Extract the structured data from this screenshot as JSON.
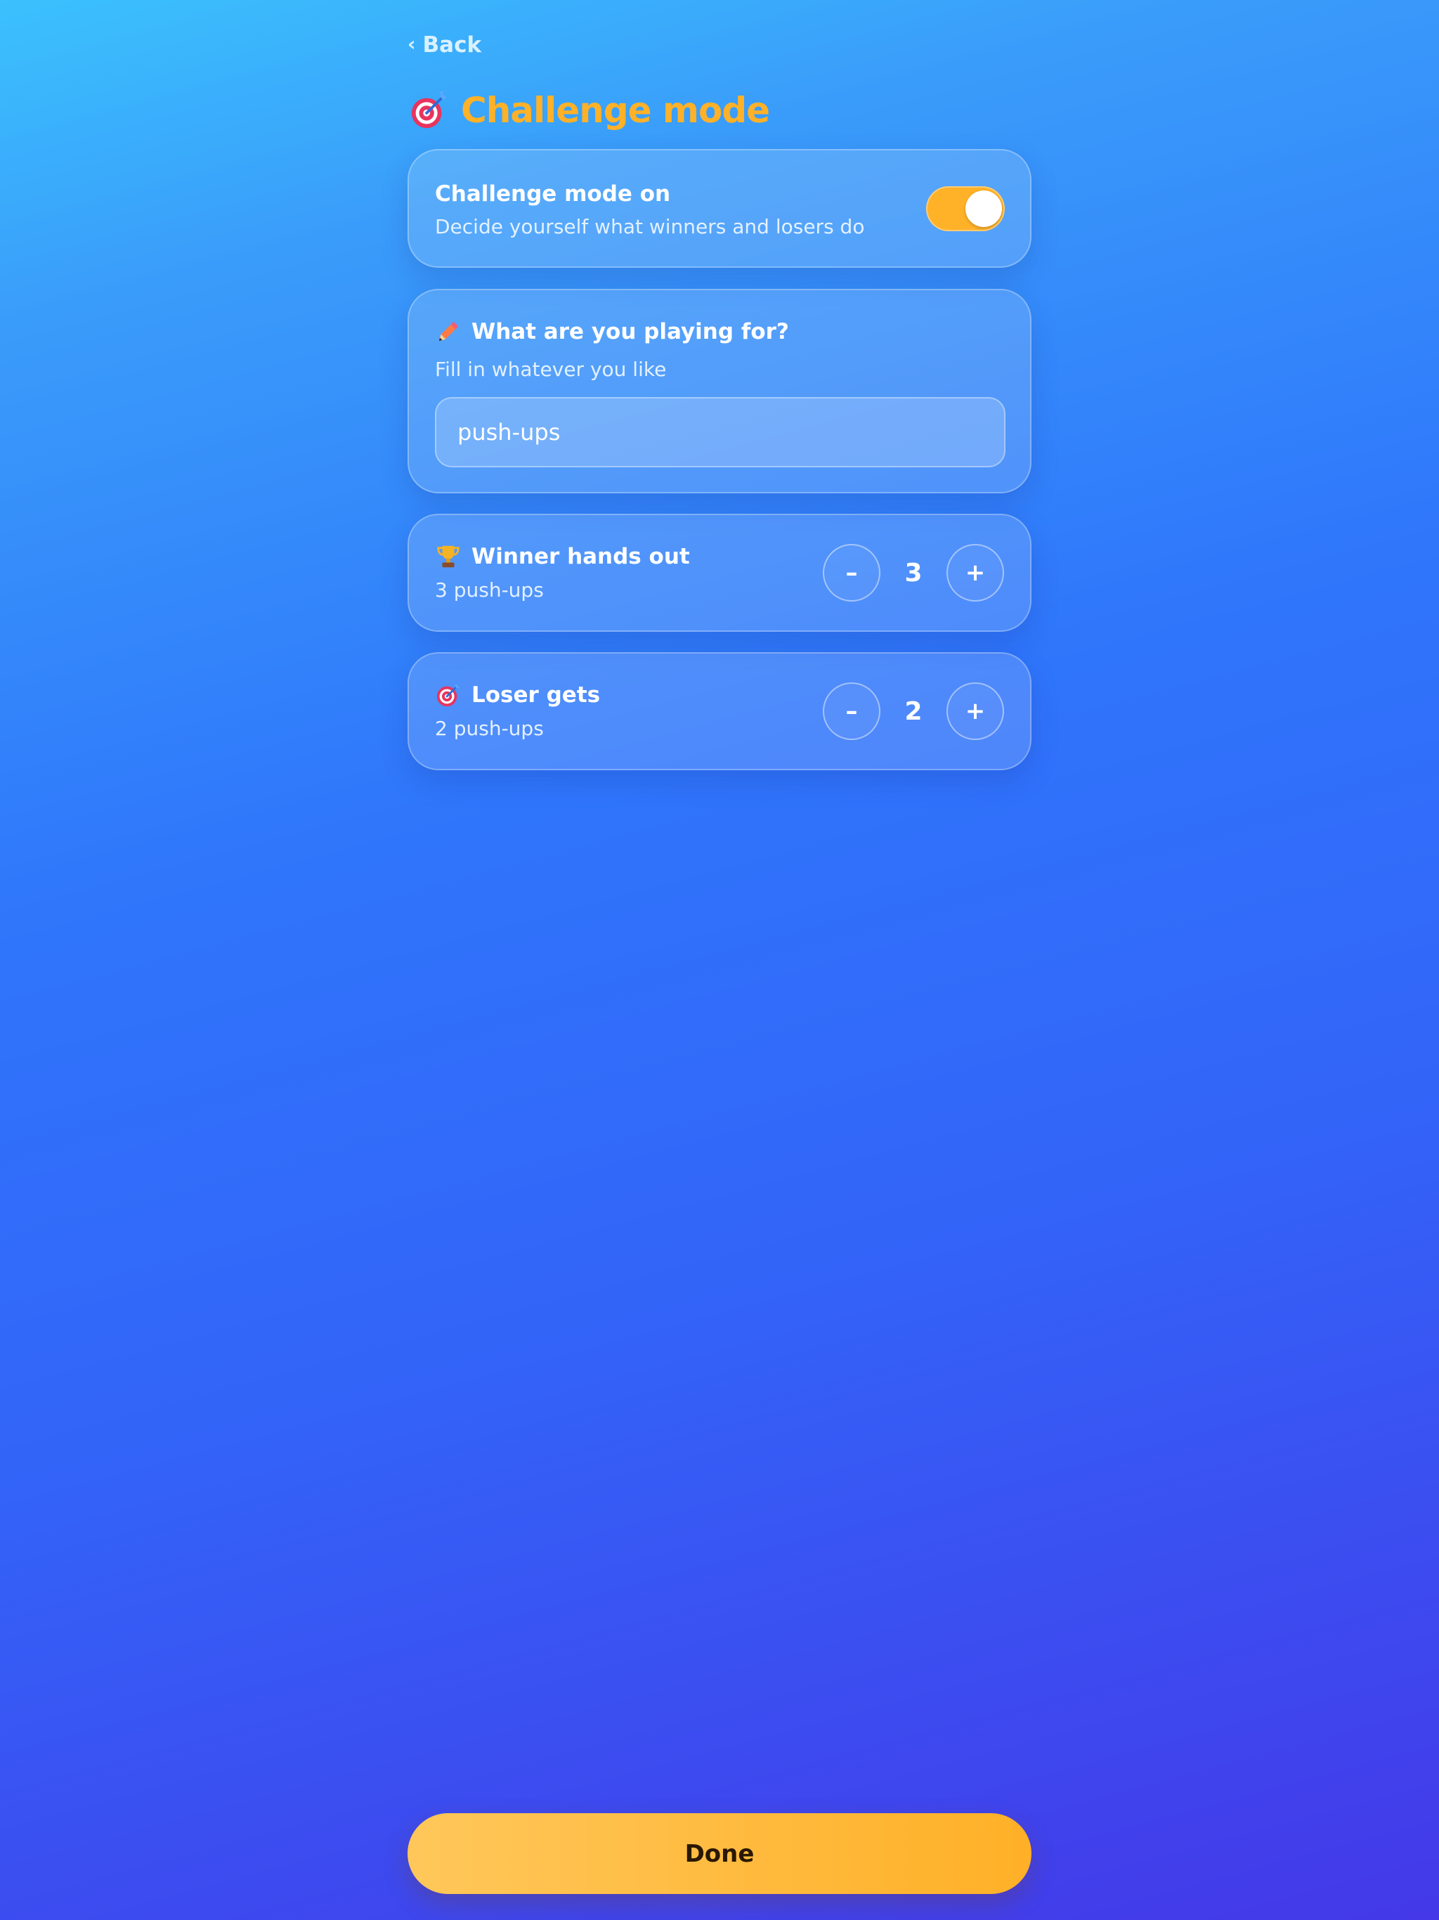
{
  "nav": {
    "back_label": "Back"
  },
  "header": {
    "title": "Challenge mode",
    "icon": "target-icon"
  },
  "toggle_card": {
    "title": "Challenge mode on",
    "subtitle": "Decide yourself what winners and losers do",
    "enabled": true
  },
  "play_card": {
    "icon": "pencil-icon",
    "title": "What are you playing for?",
    "subtitle": "Fill in whatever you like",
    "input_value": "push-ups"
  },
  "winner_card": {
    "icon": "trophy-icon",
    "title": "Winner hands out",
    "subtitle": "3 push-ups",
    "decrement_label": "–",
    "value": "3",
    "increment_label": "+"
  },
  "loser_card": {
    "icon": "target-icon",
    "title": "Loser gets",
    "subtitle": "2 push-ups",
    "decrement_label": "–",
    "value": "2",
    "increment_label": "+"
  },
  "footer": {
    "done_label": "Done"
  },
  "colors": {
    "accent": "#ffb128",
    "background_top": "#3bc1fd",
    "background_bottom": "#4438e8"
  }
}
